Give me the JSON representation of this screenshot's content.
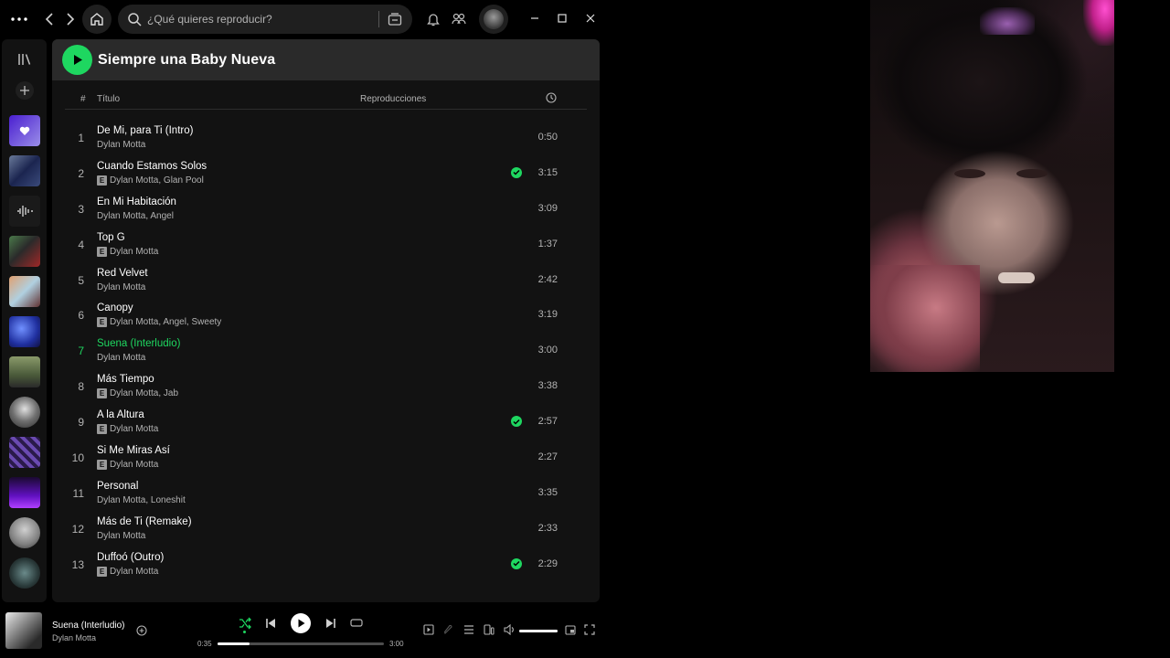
{
  "topbar": {
    "menu_icon": "more-horizontal-icon",
    "search_placeholder": "¿Qué quieres reproducir?"
  },
  "sidebar": {
    "icons": [
      "library-icon",
      "plus-icon"
    ],
    "items": [
      {
        "name": "liked-songs",
        "color": "#7b4ff0"
      },
      {
        "name": "playlist-1",
        "color": "#2c3e6b"
      },
      {
        "name": "playlist-2",
        "color": "#2a2a2a"
      },
      {
        "name": "playlist-3",
        "color": "#8a3030"
      },
      {
        "name": "playlist-4",
        "color": "#b86a3a"
      },
      {
        "name": "playlist-5",
        "color": "#3040a0"
      },
      {
        "name": "playlist-6",
        "color": "#5a6a3a"
      },
      {
        "name": "artist-1",
        "color": "#7a7a7a"
      },
      {
        "name": "playlist-7",
        "color": "#5a3a8a"
      },
      {
        "name": "playlist-8",
        "color": "#7020c0"
      },
      {
        "name": "artist-2",
        "color": "#909090"
      },
      {
        "name": "artist-3",
        "color": "#3a4a4a"
      }
    ]
  },
  "playlist": {
    "title": "Siempre una Baby Nueva",
    "columns": {
      "num": "#",
      "title": "Título",
      "plays": "Reproducciones"
    },
    "active_index": 6,
    "tracks": [
      {
        "num": "1",
        "title": "De Mi, para Ti (Intro)",
        "artist": "Dylan Motta",
        "explicit": false,
        "saved": false,
        "duration": "0:50"
      },
      {
        "num": "2",
        "title": "Cuando Estamos Solos",
        "artist": "Dylan Motta, Glan Pool",
        "explicit": true,
        "saved": true,
        "duration": "3:15"
      },
      {
        "num": "3",
        "title": "En Mi Habitación",
        "artist": "Dylan Motta, Angel",
        "explicit": false,
        "saved": false,
        "duration": "3:09"
      },
      {
        "num": "4",
        "title": "Top G",
        "artist": "Dylan Motta",
        "explicit": true,
        "saved": false,
        "duration": "1:37"
      },
      {
        "num": "5",
        "title": "Red Velvet",
        "artist": "Dylan Motta",
        "explicit": false,
        "saved": false,
        "duration": "2:42"
      },
      {
        "num": "6",
        "title": "Canopy",
        "artist": "Dylan Motta, Angel, Sweety",
        "explicit": true,
        "saved": false,
        "duration": "3:19"
      },
      {
        "num": "7",
        "title": "Suena (Interludio)",
        "artist": "Dylan Motta",
        "explicit": false,
        "saved": false,
        "duration": "3:00"
      },
      {
        "num": "8",
        "title": "Más Tiempo",
        "artist": "Dylan Motta, Jab",
        "explicit": true,
        "saved": false,
        "duration": "3:38"
      },
      {
        "num": "9",
        "title": "A la Altura",
        "artist": "Dylan Motta",
        "explicit": true,
        "saved": true,
        "duration": "2:57"
      },
      {
        "num": "10",
        "title": "Si Me Miras Así",
        "artist": "Dylan Motta",
        "explicit": true,
        "saved": false,
        "duration": "2:27"
      },
      {
        "num": "11",
        "title": "Personal",
        "artist": "Dylan Motta, Loneshit",
        "explicit": false,
        "saved": false,
        "duration": "3:35"
      },
      {
        "num": "12",
        "title": "Más de Ti (Remake)",
        "artist": "Dylan Motta",
        "explicit": false,
        "saved": false,
        "duration": "2:33"
      },
      {
        "num": "13",
        "title": "Duffoó (Outro)",
        "artist": "Dylan Motta",
        "explicit": true,
        "saved": true,
        "duration": "2:29"
      }
    ]
  },
  "player": {
    "title": "Suena (Interludio)",
    "artist": "Dylan Motta",
    "elapsed": "0:35",
    "total": "3:00",
    "progress": 0.19,
    "volume": 1.0,
    "shuffle_active": true
  },
  "colors": {
    "accent": "#1ed760",
    "background": "#000000",
    "panel": "#121212"
  }
}
